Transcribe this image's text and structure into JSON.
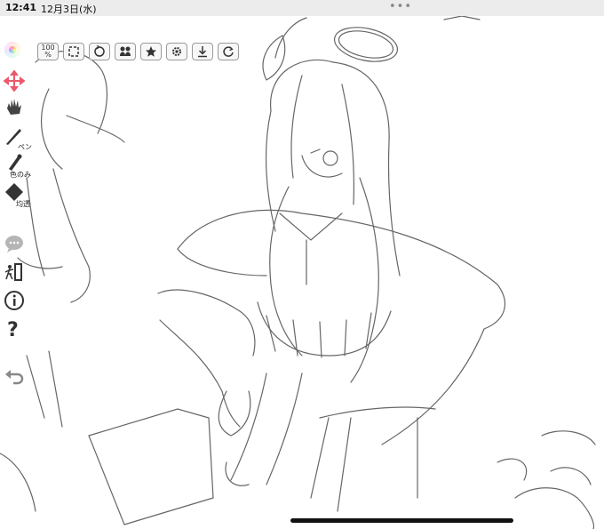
{
  "status_bar": {
    "time": "12:41",
    "date": "12月3日(水)",
    "dots": "•••"
  },
  "toolbar": {
    "zoom_label": "100\n%",
    "buttons": [
      "zoom-100-icon",
      "fit-screen-icon",
      "rotate-icon",
      "layers-icon",
      "star-icon",
      "gear-icon",
      "download-icon",
      "redo-icon"
    ]
  },
  "side_tools": {
    "pen_label": "ペン",
    "color_label": "色のみ",
    "transparent_label": "均透"
  },
  "colors": {
    "accent_move": "#e85a6a",
    "ui_gray": "#9a9a9a",
    "line": "#555555"
  }
}
